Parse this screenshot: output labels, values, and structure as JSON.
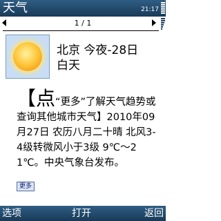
{
  "status_bar": {
    "app_title": "天气",
    "clock": "21:17",
    "battery_icon": "battery-icon",
    "signal_icon": "signal-strength-icon"
  },
  "pager": {
    "indicator": "1 / 1"
  },
  "weather": {
    "icon": "sunny-icon",
    "location_line": "北京 今夜-28日",
    "period_line": "白天"
  },
  "forecast": {
    "bracket_open": "【",
    "lead_char": "点",
    "text": "“更多”了解天气趋势或查询其他城市天气】2010年09月27日 农历八月二十晴 北风3-4级转微风小于3级 9℃～21℃。中央气象台发布。"
  },
  "more_link": {
    "label": "更多"
  },
  "softkeys": {
    "left": "选项",
    "center": "打开",
    "right": "返回"
  },
  "colors": {
    "title_bar": "#24496b",
    "icon_background": "#c9def4",
    "more_button_background": "#d9e3f7"
  }
}
